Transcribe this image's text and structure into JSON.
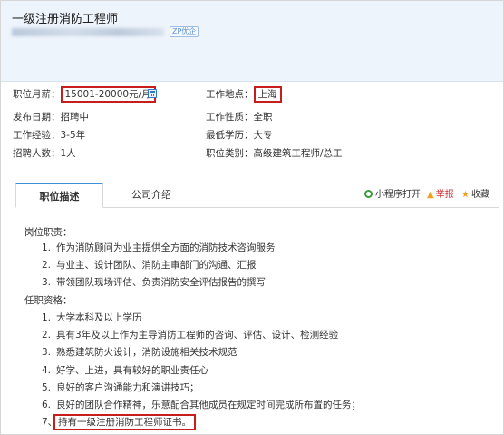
{
  "header": {
    "job_title": "一级注册消防工程师",
    "badge": "ZP优企"
  },
  "info": {
    "salary_label": "职位月薪：",
    "salary_value": "15001-20000元/月",
    "location_label": "工作地点：",
    "location_value": "上海",
    "publish_label": "发布日期：",
    "publish_value": "招聘中",
    "nature_label": "工作性质：",
    "nature_value": "全职",
    "experience_label": "工作经验：",
    "experience_value": "3-5年",
    "education_label": "最低学历：",
    "education_value": "大专",
    "headcount_label": "招聘人数：",
    "headcount_value": "1人",
    "category_label": "职位类别：",
    "category_value": "高级建筑工程师/总工"
  },
  "tabs": {
    "description": "职位描述",
    "company": "公司介绍"
  },
  "actions": {
    "miniprogram": "小程序打开",
    "report": "举报",
    "favorite": "收藏"
  },
  "colors": {
    "highlight_border": "#c81d1d",
    "tab_accent": "#3e8edb",
    "header_bg": "#eef4fb",
    "report_red": "#d03030",
    "link_blue": "#2f75c9"
  },
  "description": {
    "duties_heading": "岗位职责：",
    "duties": [
      {
        "num": "1.",
        "text": "作为消防顾问为业主提供全方面的消防技术咨询服务"
      },
      {
        "num": "2.",
        "text": "与业主、设计团队、消防主审部门的沟通、汇报"
      },
      {
        "num": "3.",
        "text": "带领团队现场评估、负责消防安全评估报告的撰写"
      }
    ],
    "requirements_heading": "任职资格：",
    "requirements": [
      {
        "num": "1.",
        "text": "大学本科及以上学历"
      },
      {
        "num": "2.",
        "text": "具有3年及以上作为主导消防工程师的咨询、评估、设计、检测经验"
      },
      {
        "num": "3.",
        "text": "熟悉建筑防火设计，消防设施相关技术规范"
      },
      {
        "num": "4.",
        "text": "好学、上进，具有较好的职业责任心"
      },
      {
        "num": "5.",
        "text": "良好的客户沟通能力和演讲技巧；"
      },
      {
        "num": "6.",
        "text": "良好的团队合作精神，乐意配合其他成员在规定时间完成所布置的任务；"
      },
      {
        "num": "7、",
        "text": "持有一级注册消防工程师证书。"
      }
    ]
  }
}
